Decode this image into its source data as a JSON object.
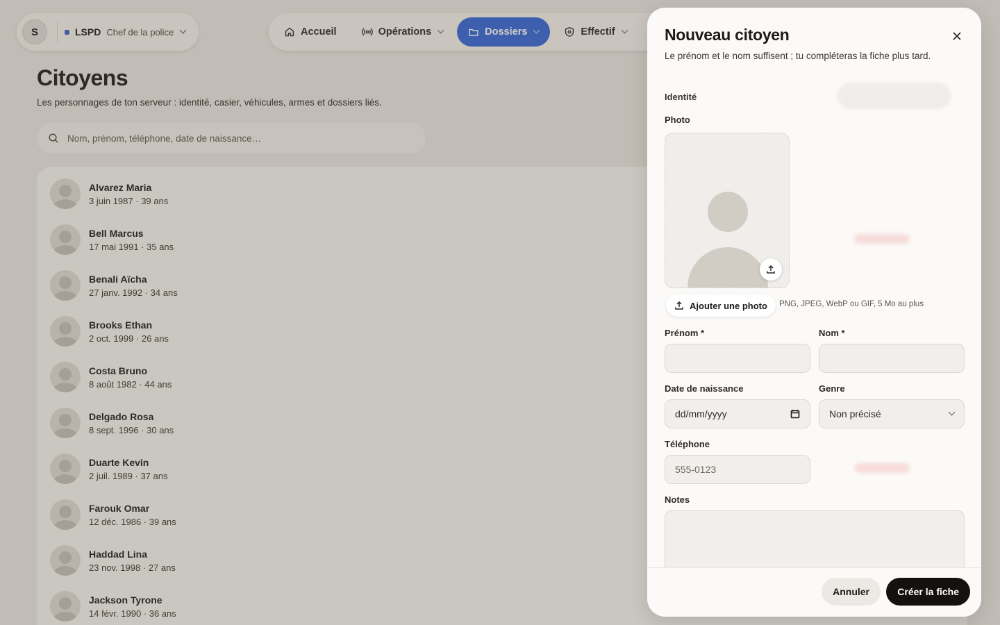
{
  "workspace": {
    "initial": "S",
    "org": "LSPD",
    "role": "Chef de la police"
  },
  "nav": {
    "items": [
      {
        "label": "Accueil",
        "icon": "home-icon",
        "active": false,
        "dropdown": false
      },
      {
        "label": "Opérations",
        "icon": "broadcast-icon",
        "active": false,
        "dropdown": true
      },
      {
        "label": "Dossiers",
        "icon": "folder-icon",
        "active": true,
        "dropdown": true
      },
      {
        "label": "Effectif",
        "icon": "badge-icon",
        "active": false,
        "dropdown": true
      }
    ]
  },
  "page": {
    "title": "Citoyens",
    "subtitle": "Les personnages de ton serveur : identité, casier, véhicules, armes et dossiers liés.",
    "search_placeholder": "Nom, prénom, téléphone, date de naissance…"
  },
  "citizens": [
    {
      "name": "Alvarez Maria",
      "dob": "3 juin 1987",
      "age": "39 ans"
    },
    {
      "name": "Bell Marcus",
      "dob": "17 mai 1991",
      "age": "35 ans"
    },
    {
      "name": "Benali Aïcha",
      "dob": "27 janv. 1992",
      "age": "34 ans"
    },
    {
      "name": "Brooks Ethan",
      "dob": "2 oct. 1999",
      "age": "26 ans"
    },
    {
      "name": "Costa Bruno",
      "dob": "8 août 1982",
      "age": "44 ans"
    },
    {
      "name": "Delgado Rosa",
      "dob": "8 sept. 1996",
      "age": "30 ans"
    },
    {
      "name": "Duarte Kevin",
      "dob": "2 juil. 1989",
      "age": "37 ans"
    },
    {
      "name": "Farouk Omar",
      "dob": "12 déc. 1986",
      "age": "39 ans"
    },
    {
      "name": "Haddad Lina",
      "dob": "23 nov. 1998",
      "age": "27 ans"
    },
    {
      "name": "Jackson Tyrone",
      "dob": "14 févr. 1990",
      "age": "36 ans"
    }
  ],
  "drawer": {
    "title": "Nouveau citoyen",
    "description": "Le prénom et le nom suffisent ; tu compléteras la fiche plus tard.",
    "section_identity": "Identité",
    "photo_label": "Photo",
    "add_photo": "Ajouter une photo",
    "photo_hint": "PNG, JPEG, WebP ou GIF, 5 Mo au plus",
    "prenom_label": "Prénom *",
    "nom_label": "Nom *",
    "dob_label": "Date de naissance",
    "dob_placeholder": "dd/mm/yyyy",
    "genre_label": "Genre",
    "genre_value": "Non précisé",
    "phone_label": "Téléphone",
    "phone_placeholder": "555-0123",
    "notes_label": "Notes",
    "cancel": "Annuler",
    "create": "Créer la fiche"
  },
  "colors": {
    "accent": "#3366d6",
    "primary_button": "#141210",
    "org_dot": "#3b63c9"
  }
}
